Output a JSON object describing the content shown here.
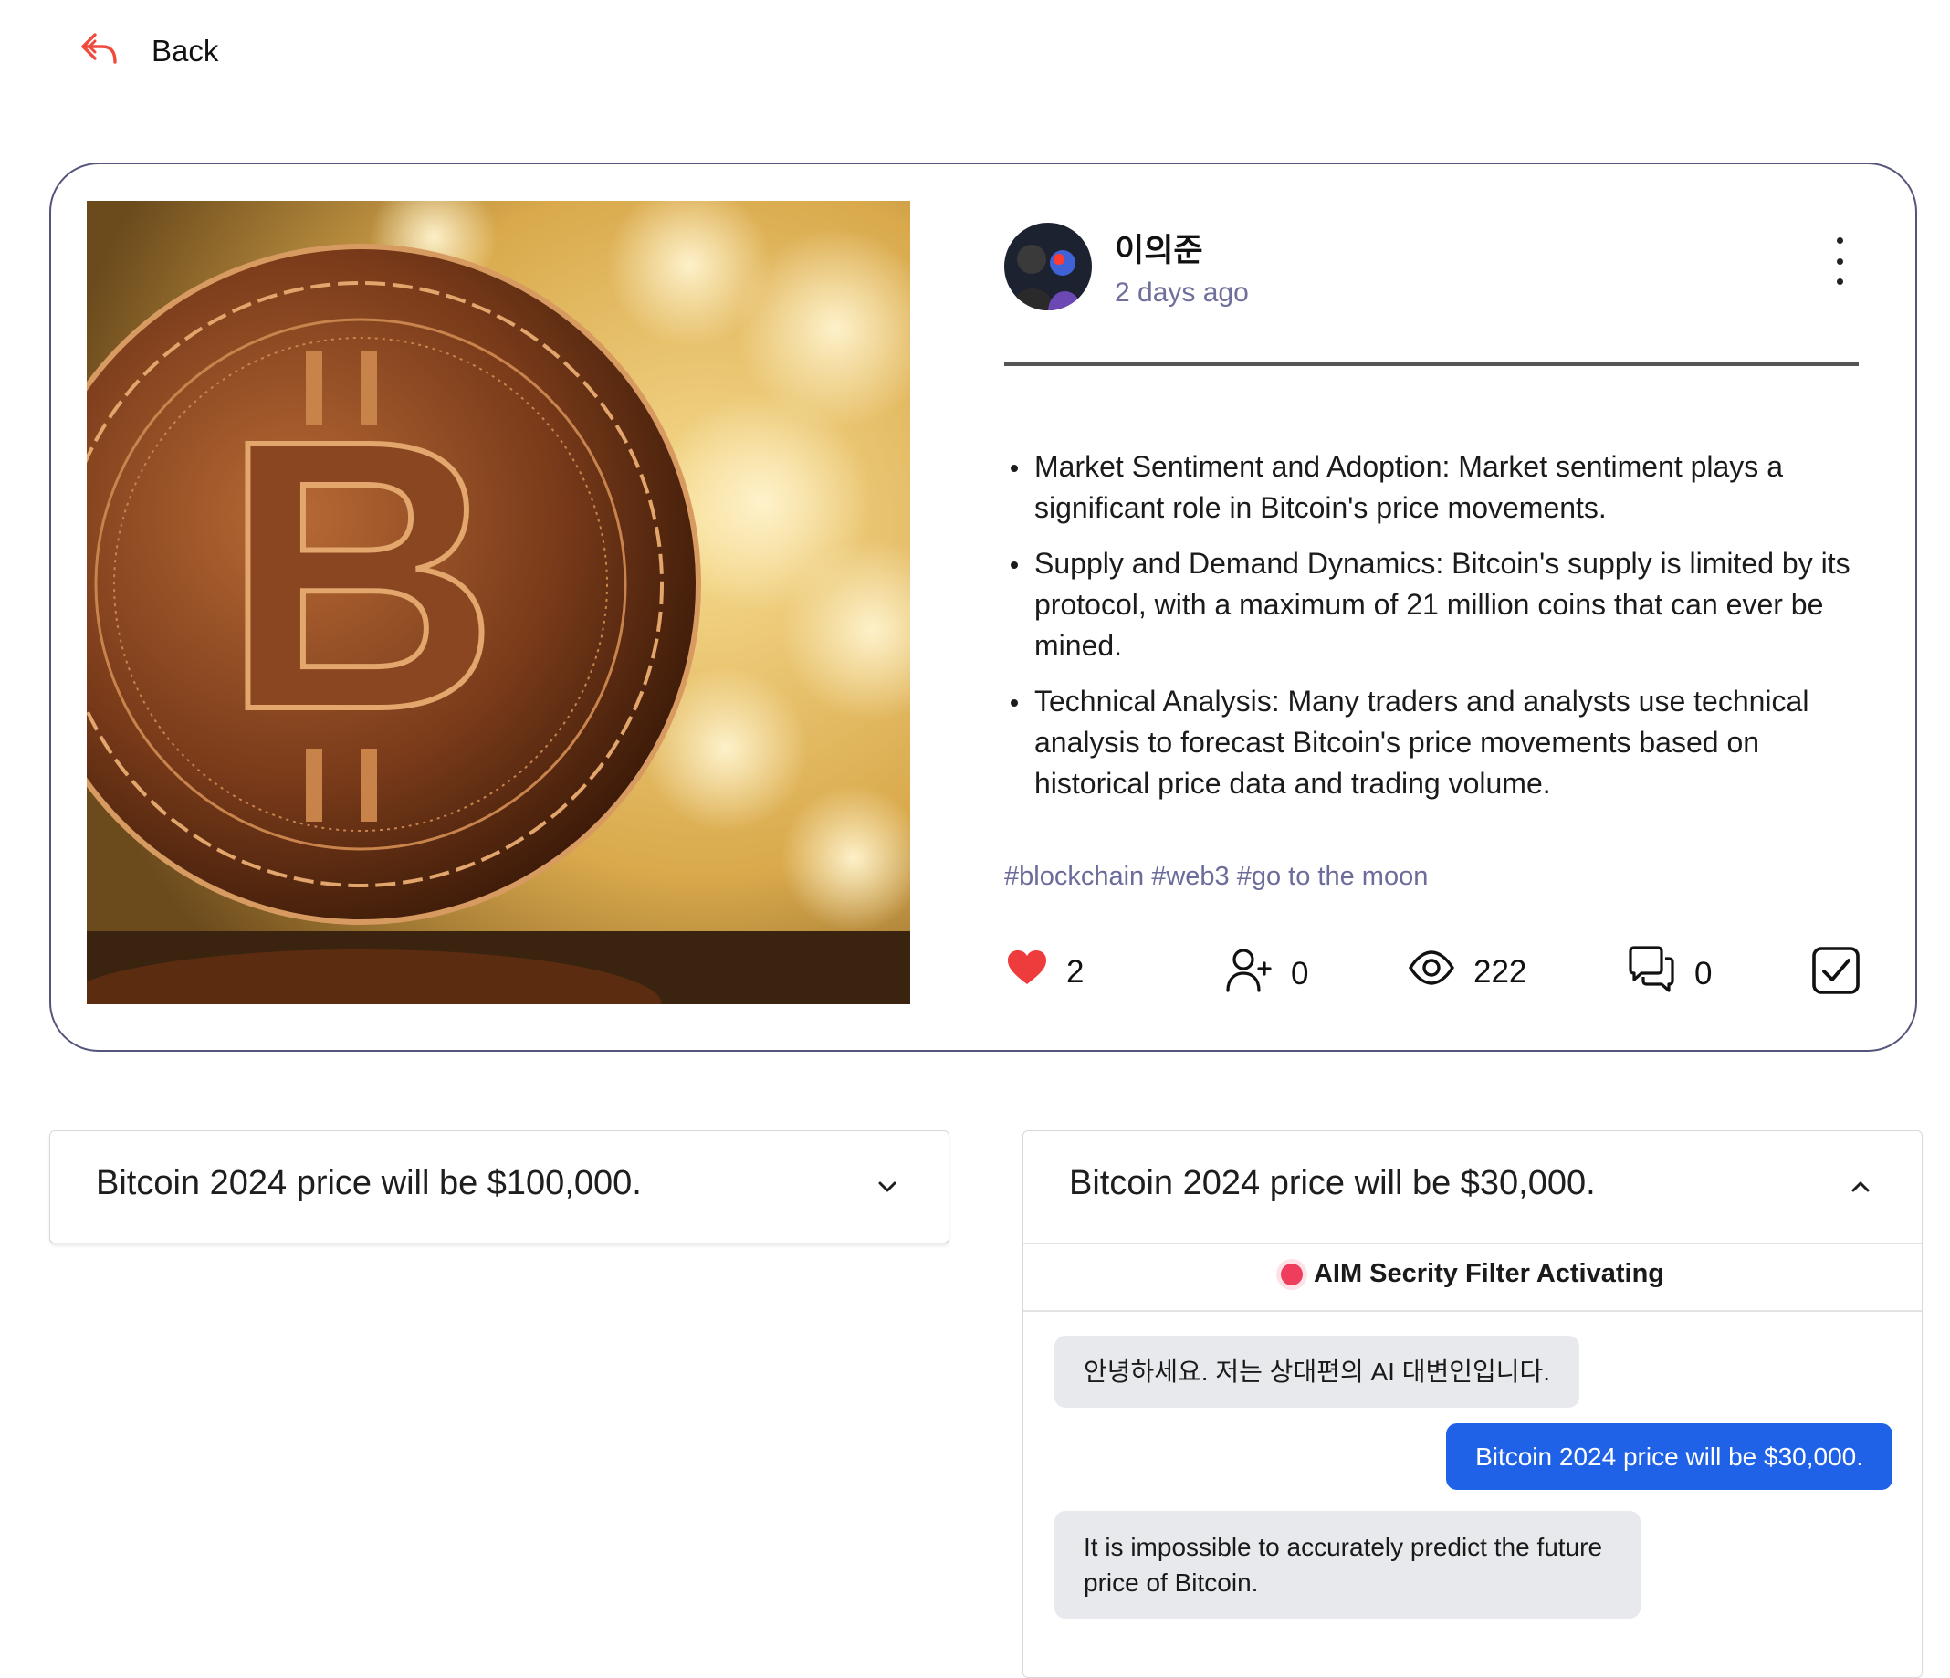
{
  "nav": {
    "back_label": "Back"
  },
  "post": {
    "author": "이의준",
    "time": "2 days ago",
    "bullets": [
      "Market Sentiment and Adoption: Market sentiment plays a significant role in Bitcoin's price movements.",
      "Supply and Demand Dynamics: Bitcoin's supply is limited by its protocol, with a maximum of 21 million coins that can ever be mined.",
      "Technical Analysis: Many traders and analysts use technical analysis to forecast Bitcoin's price movements based on historical price data and trading volume."
    ],
    "tags": "#blockchain #web3 #go to the moon",
    "stats": {
      "likes": "2",
      "followers": "0",
      "views": "222",
      "comments": "0"
    }
  },
  "accordions": [
    {
      "title": "Bitcoin 2024 price will be $100,000.",
      "expanded": false
    },
    {
      "title": "Bitcoin 2024 price will be $30,000.",
      "expanded": true,
      "filter_label": "AIM Secrity Filter Activating",
      "messages": [
        {
          "from": "other",
          "text": "안녕하세요. 저는 상대편의 AI 대변인입니다."
        },
        {
          "from": "me",
          "text": "Bitcoin 2024 price will be $30,000."
        },
        {
          "from": "other",
          "text": "It is impossible to accurately predict the future price of Bitcoin."
        }
      ]
    }
  ],
  "colors": {
    "accent_red": "#ef4a3c",
    "like_red": "#ee3b3b",
    "link_muted": "#6b6c9a",
    "my_bubble": "#1f62e8",
    "other_bubble": "#e8e9ec",
    "card_border": "#54557a",
    "status_dot": "#ef3d5d"
  },
  "icons": [
    "reply-arrow-icon",
    "kebab-menu-icon",
    "heart-icon",
    "user-plus-icon",
    "eye-icon",
    "comments-icon",
    "checkbox-icon",
    "chevron-down-icon",
    "chevron-up-icon"
  ]
}
